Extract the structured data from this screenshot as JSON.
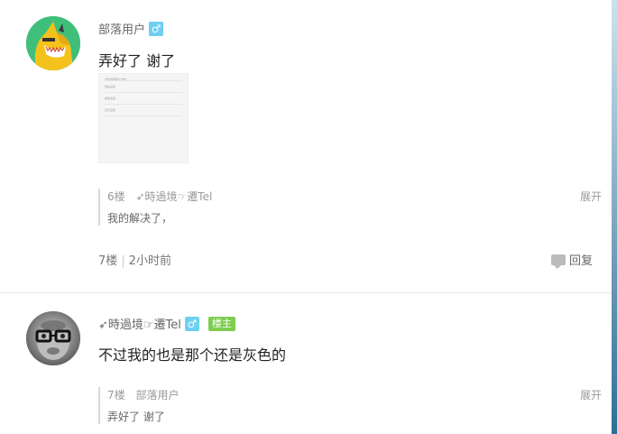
{
  "post1": {
    "username": "部落用户",
    "gender_symbol": "♂",
    "content": "弄好了 谢了",
    "thumb_title": "设置选项默认开启",
    "thumb_rows": [
      "隐私设置",
      "推送设置",
      "显示设置"
    ],
    "reply": {
      "floor": "6楼",
      "user": "➶時過境☞遷Tel",
      "expand": "展开",
      "text": "我的解决了，"
    },
    "footer": {
      "floor": "7楼",
      "separator": "|",
      "time": "2小时前",
      "reply_label": "回复"
    }
  },
  "post2": {
    "username": "➶時過境☞遷Tel",
    "gender_symbol": "♂",
    "host_badge": "楼主",
    "content": "不过我的也是那个还是灰色的",
    "reply": {
      "floor": "7楼",
      "user": "部落用户",
      "expand": "展开",
      "text": "弄好了 谢了"
    }
  },
  "colors": {
    "gender": "#6ecff0",
    "host_badge": "#7dcd4f",
    "shark_bg": "#3fbf7a",
    "shark_body": "#f5c21b"
  }
}
